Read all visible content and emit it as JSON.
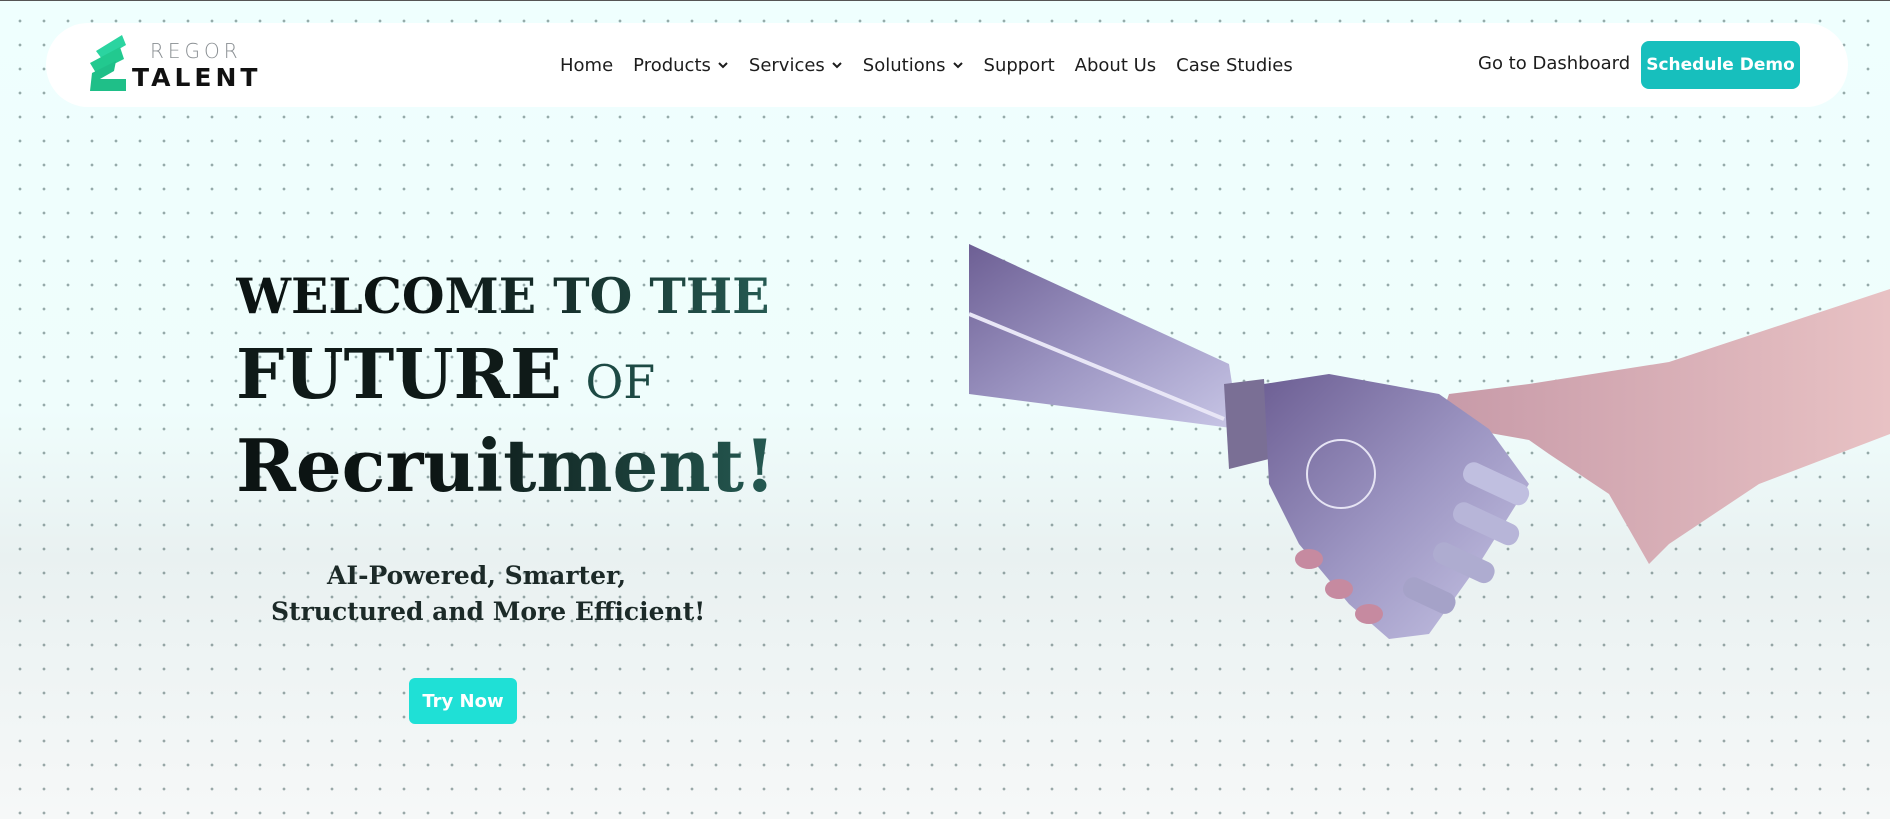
{
  "brand": {
    "name_top": "REGOR",
    "name_bottom": "TALENT",
    "accent_color": "#17bfbd",
    "logo_color": "#2bd4a0"
  },
  "nav": {
    "items": [
      {
        "label": "Home",
        "has_dropdown": false
      },
      {
        "label": "Products",
        "has_dropdown": true
      },
      {
        "label": "Services",
        "has_dropdown": true
      },
      {
        "label": "Solutions",
        "has_dropdown": true
      },
      {
        "label": "Support",
        "has_dropdown": false
      },
      {
        "label": "About Us",
        "has_dropdown": false
      },
      {
        "label": "Case Studies",
        "has_dropdown": false
      }
    ],
    "dashboard_link": "Go to Dashboard",
    "cta": "Schedule Demo"
  },
  "hero": {
    "line1": "WELCOME TO THE",
    "line2_main": "FUTURE",
    "line2_small": "OF",
    "line3": "Recruitment!",
    "subtitle_line1": "AI-Powered, Smarter,",
    "subtitle_line2": "Structured and More Efficient!",
    "cta": "Try Now",
    "image_icon": "robot-human-handshake-image"
  }
}
